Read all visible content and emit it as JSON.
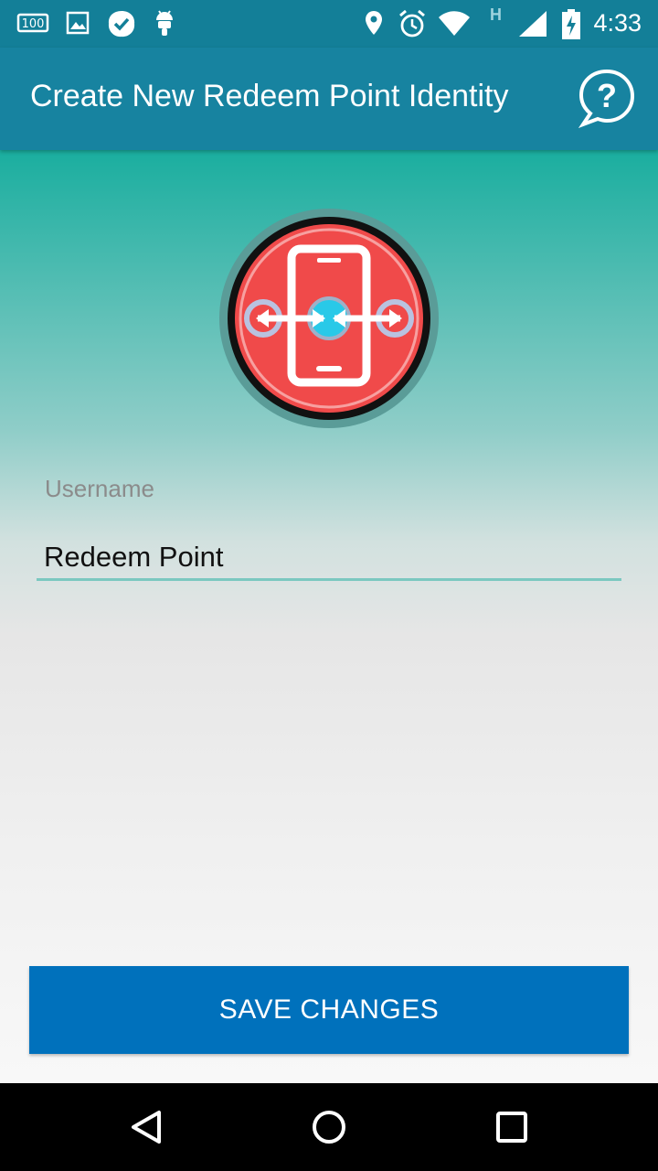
{
  "statusbar": {
    "time": "4:33",
    "network_label": "H",
    "icons": [
      "battery-100-notification-icon",
      "image-icon",
      "check-badge-icon",
      "android-icon",
      "location-icon",
      "alarm-icon",
      "wifi-icon",
      "signal-icon",
      "battery-charging-icon"
    ]
  },
  "appbar": {
    "title": "Create New Redeem Point Identity",
    "help_icon": "help-chat-icon"
  },
  "avatar": {
    "icon": "phone-exchange-logo-icon",
    "colors": {
      "ring": "#5a9c98",
      "fill": "#f04a4a",
      "center": "#29c9e8"
    }
  },
  "form": {
    "username_label": "Username",
    "username_value": "Redeem Point"
  },
  "actions": {
    "save_label": "SAVE CHANGES"
  },
  "navbar": {
    "icons": [
      "back-icon",
      "home-icon",
      "recents-icon"
    ]
  },
  "colors": {
    "statusbar": "#137f98",
    "appbar": "#1783a0",
    "accent": "#0071bc",
    "underline": "#7bc8c0"
  }
}
